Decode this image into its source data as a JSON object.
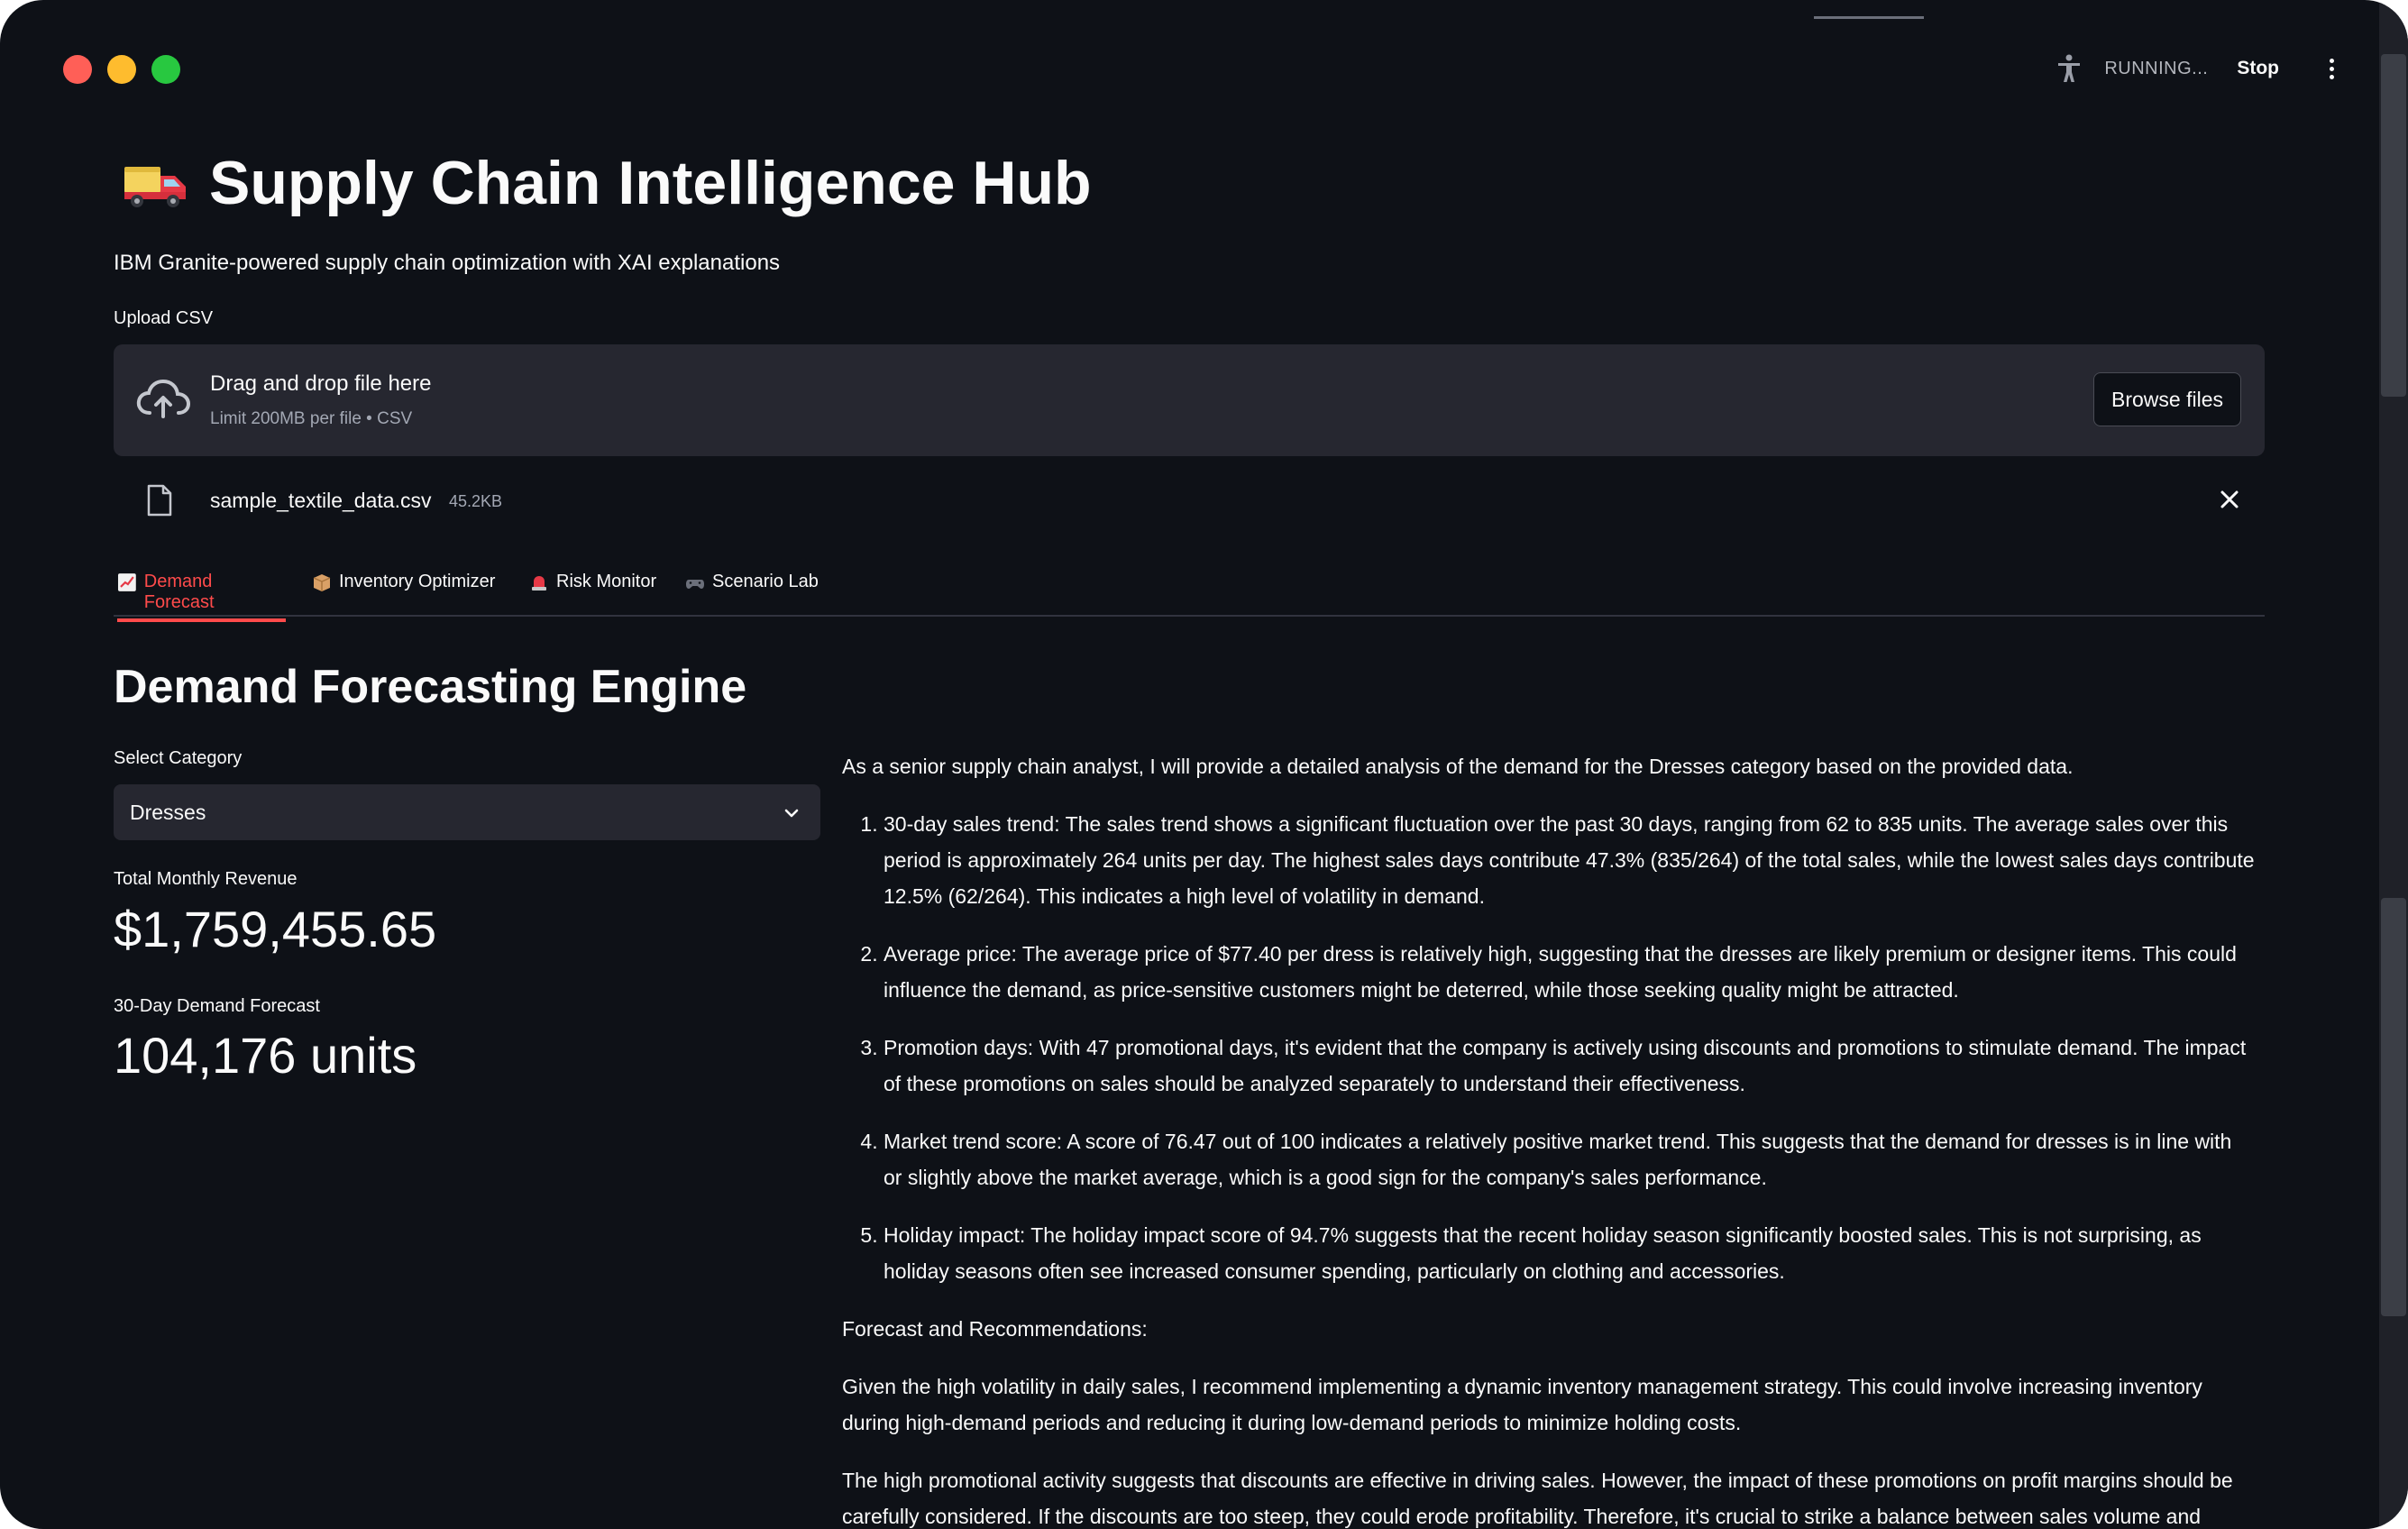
{
  "status": {
    "running_label": "RUNNING...",
    "stop_label": "Stop"
  },
  "header": {
    "title": "Supply Chain Intelligence Hub",
    "subtitle": "IBM Granite-powered supply chain optimization with XAI explanations"
  },
  "upload": {
    "label": "Upload CSV",
    "drop_text": "Drag and drop file here",
    "limit_text": "Limit 200MB per file • CSV",
    "browse_label": "Browse files",
    "file": {
      "name": "sample_textile_data.csv",
      "size": "45.2KB"
    }
  },
  "tabs": [
    {
      "label": "Demand Forecast",
      "icon": "chart-icon",
      "active": true
    },
    {
      "label": "Inventory Optimizer",
      "icon": "box-icon",
      "active": false
    },
    {
      "label": "Risk Monitor",
      "icon": "siren-icon",
      "active": false
    },
    {
      "label": "Scenario Lab",
      "icon": "gamepad-icon",
      "active": false
    }
  ],
  "section": {
    "title": "Demand Forecasting Engine",
    "select_label": "Select Category",
    "selected_category": "Dresses",
    "metrics": [
      {
        "label": "Total Monthly Revenue",
        "value": "$1,759,455.65"
      },
      {
        "label": "30-Day Demand Forecast",
        "value": "104,176 units"
      }
    ]
  },
  "analysis": {
    "intro": "As a senior supply chain analyst, I will provide a detailed analysis of the demand for the Dresses category based on the provided data.",
    "items": [
      "30-day sales trend: The sales trend shows a significant fluctuation over the past 30 days, ranging from 62 to 835 units. The average sales over this period is approximately 264 units per day. The highest sales days contribute 47.3% (835/264) of the total sales, while the lowest sales days contribute 12.5% (62/264). This indicates a high level of volatility in demand.",
      "Average price: The average price of $77.40 per dress is relatively high, suggesting that the dresses are likely premium or designer items. This could influence the demand, as price-sensitive customers might be deterred, while those seeking quality might be attracted.",
      "Promotion days: With 47 promotional days, it's evident that the company is actively using discounts and promotions to stimulate demand. The impact of these promotions on sales should be analyzed separately to understand their effectiveness.",
      "Market trend score: A score of 76.47 out of 100 indicates a relatively positive market trend. This suggests that the demand for dresses is in line with or slightly above the market average, which is a good sign for the company's sales performance.",
      "Holiday impact: The holiday impact score of 94.7% suggests that the recent holiday season significantly boosted sales. This is not surprising, as holiday seasons often see increased consumer spending, particularly on clothing and accessories."
    ],
    "forecast_heading": "Forecast and Recommendations:",
    "paragraph1": "Given the high volatility in daily sales, I recommend implementing a dynamic inventory management strategy. This could involve increasing inventory during high-demand periods and reducing it during low-demand periods to minimize holding costs.",
    "paragraph2": "The high promotional activity suggests that discounts are effective in driving sales. However, the impact of these promotions on profit margins should be carefully considered. If the discounts are too steep, they could erode profitability. Therefore, it's crucial to strike a balance between sales volume and"
  },
  "colors": {
    "background": "#0e1117",
    "panel": "#262730",
    "accent": "#ff4b4b",
    "text": "#fafafa"
  }
}
